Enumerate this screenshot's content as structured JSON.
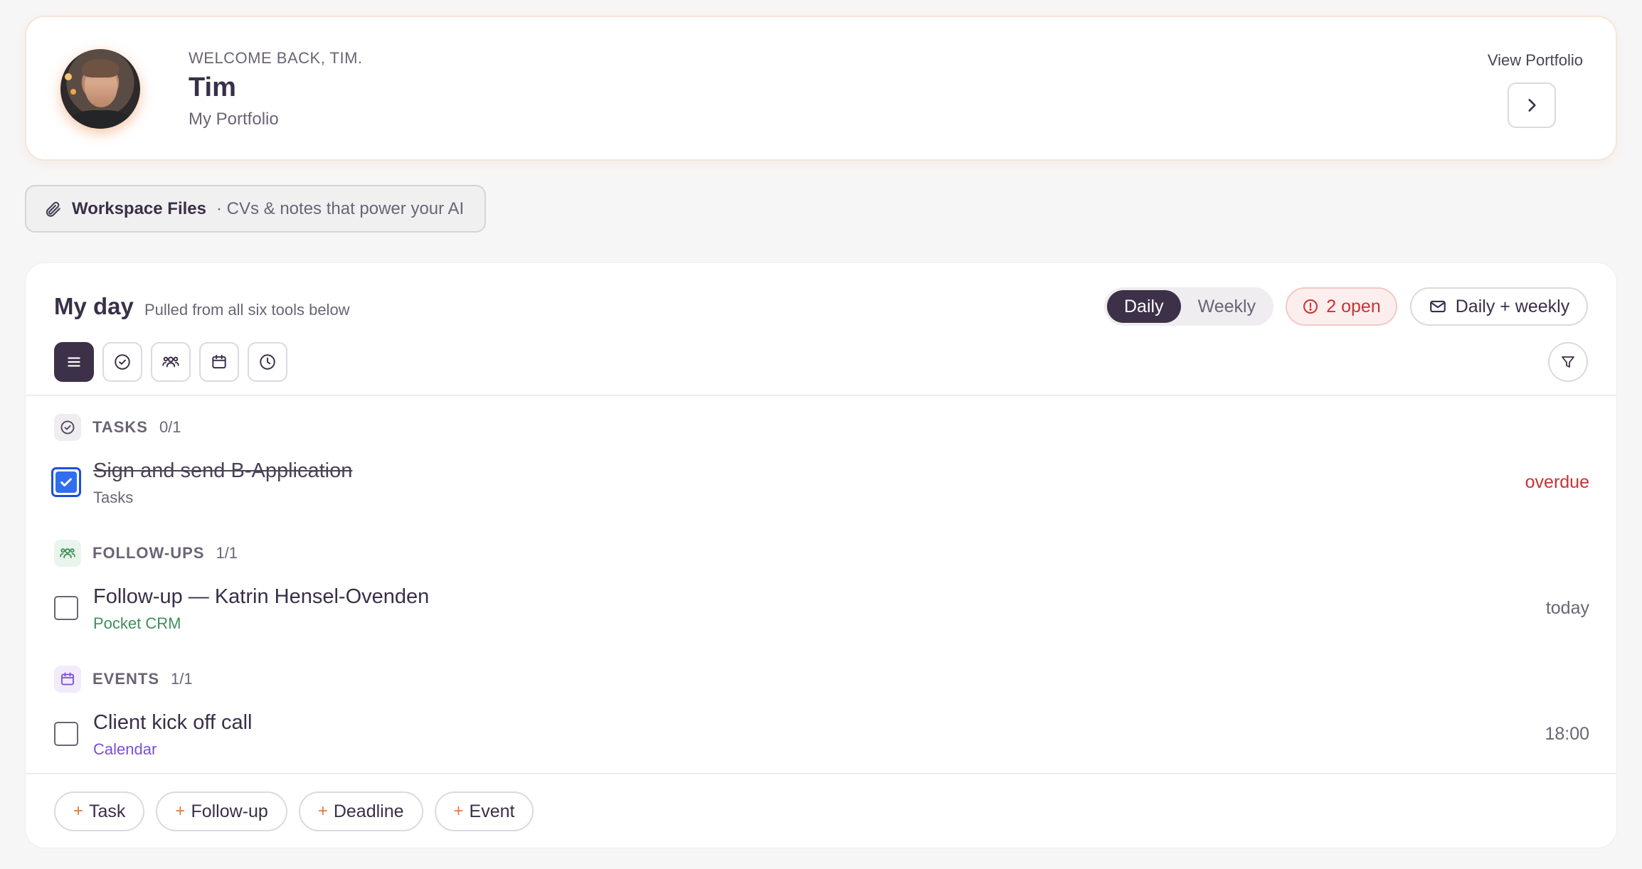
{
  "profile": {
    "welcome": "WELCOME BACK, TIM.",
    "name": "Tim",
    "subtitle": "My Portfolio",
    "view_label": "View Portfolio",
    "nav_icon": "chevron-right-icon"
  },
  "workspace": {
    "icon": "paperclip-icon",
    "title": "Workspace Files",
    "description": "· CVs & notes that power your AI"
  },
  "myday": {
    "title": "My day",
    "subtitle": "Pulled from all six tools below",
    "view_toggle": {
      "options": [
        "Daily",
        "Weekly"
      ],
      "selected": "Daily"
    },
    "open_badge": "2 open",
    "digest_button": "Daily + weekly",
    "filter_icons": [
      "list-icon",
      "check-circle-icon",
      "people-icon",
      "calendar-icon",
      "clock-icon"
    ],
    "active_filter": "list-icon",
    "sections": [
      {
        "label": "TASKS",
        "count": "0/1",
        "icon": "check-circle-icon",
        "color": "#6b6475",
        "items": [
          {
            "title": "Sign and send B-Application",
            "source": "Tasks",
            "when": "overdue",
            "checked": true
          }
        ]
      },
      {
        "label": "FOLLOW-UPS",
        "count": "1/1",
        "icon": "people-icon",
        "color": "#3f8f5a",
        "items": [
          {
            "title": "Follow-up — Katrin Hensel-Ovenden",
            "source": "Pocket CRM",
            "when": "today",
            "checked": false
          }
        ]
      },
      {
        "label": "EVENTS",
        "count": "1/1",
        "icon": "calendar-icon",
        "color": "#7a4fd6",
        "items": [
          {
            "title": "Client kick off call",
            "source": "Calendar",
            "when": "18:00",
            "checked": false
          }
        ]
      }
    ],
    "add_buttons": [
      "Task",
      "Follow-up",
      "Deadline",
      "Event"
    ],
    "add_symbol": "+"
  },
  "colors": {
    "accent_dark": "#3d3149",
    "overdue": "#c83333",
    "checkbox_blue": "#2f6fef",
    "plus_orange": "#e07a3a"
  }
}
